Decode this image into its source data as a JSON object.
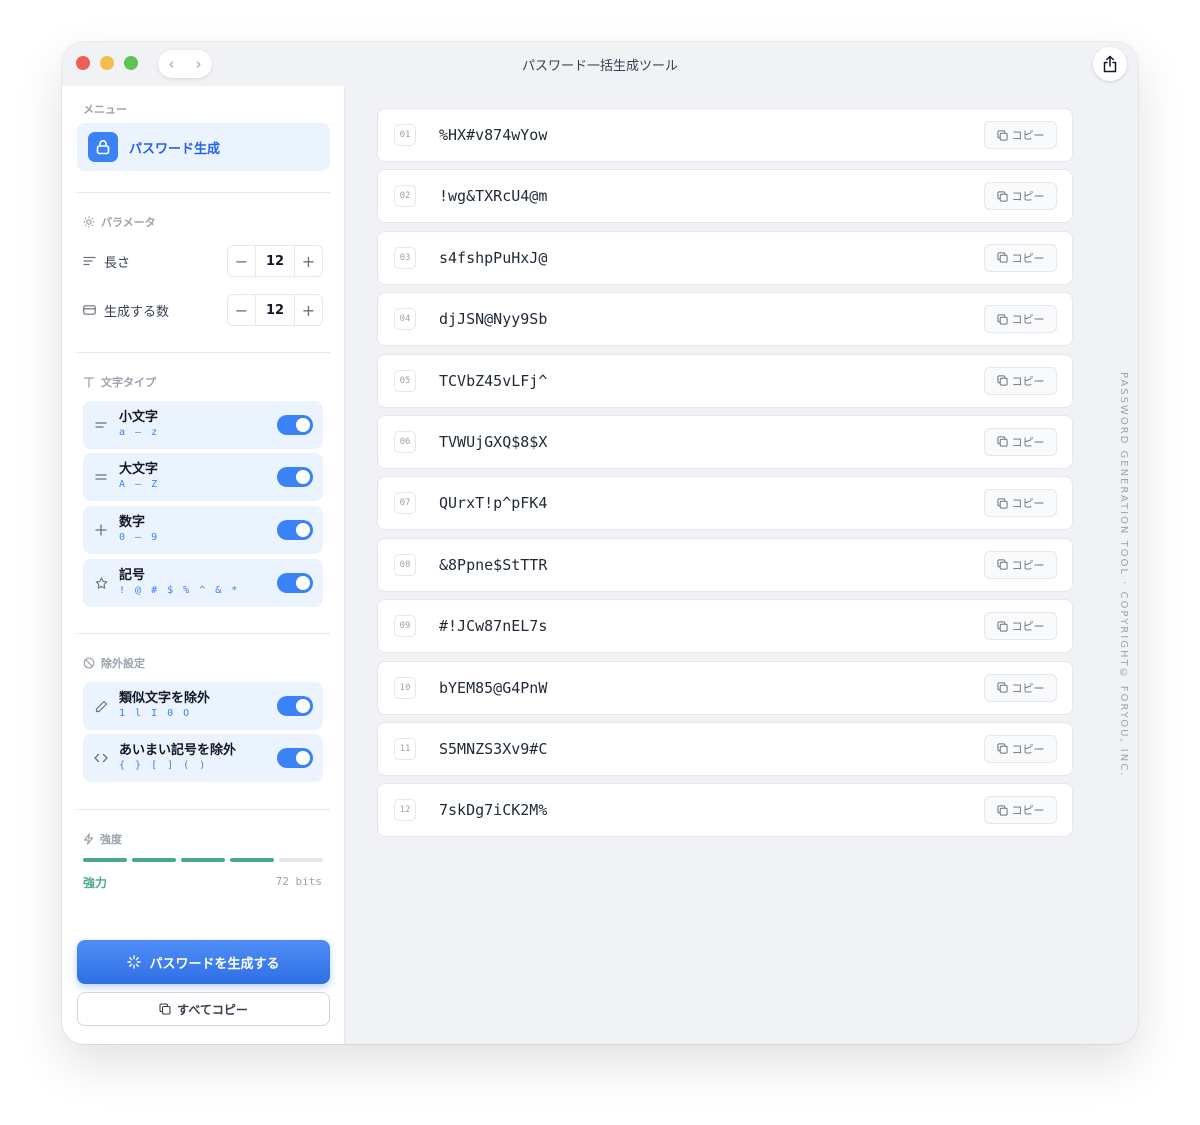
{
  "window": {
    "title": "パスワード一括生成ツール"
  },
  "sidebar": {
    "menu_label": "メニュー",
    "menu_item": "パスワード生成",
    "params": {
      "section": "パラメータ",
      "length_label": "長さ",
      "length_value": "12",
      "count_label": "生成する数",
      "count_value": "12",
      "minus": "−",
      "plus": "+"
    },
    "char_types": {
      "section": "文字タイプ",
      "items": [
        {
          "title": "小文字",
          "sub": "a – z",
          "enabled": true
        },
        {
          "title": "大文字",
          "sub": "A – Z",
          "enabled": true
        },
        {
          "title": "数字",
          "sub": "0 – 9",
          "enabled": true
        },
        {
          "title": "記号",
          "sub": "! @ # $ % ^ & *",
          "enabled": true
        }
      ]
    },
    "exclusions": {
      "section": "除外設定",
      "items": [
        {
          "title": "類似文字を除外",
          "sub": "1 l I 0 O",
          "enabled": true
        },
        {
          "title": "あいまい記号を除外",
          "sub": "{ } [ ] ( )",
          "enabled": true
        }
      ]
    },
    "strength": {
      "section": "強度",
      "label": "強力",
      "bits": "72 bits",
      "level": 0.8
    },
    "generate_button": "パスワードを生成する",
    "copy_all_button": "すべてコピー"
  },
  "passwords": [
    {
      "num": "01",
      "value": "%HX#v874wYow"
    },
    {
      "num": "02",
      "value": "!wg&TXRcU4@m"
    },
    {
      "num": "03",
      "value": "s4fshpPuHxJ@"
    },
    {
      "num": "04",
      "value": "djJSN@Nyy9Sb"
    },
    {
      "num": "05",
      "value": "TCVbZ45vLFj^"
    },
    {
      "num": "06",
      "value": "TVWUjGXQ$8$X"
    },
    {
      "num": "07",
      "value": "QUrxT!p^pFK4"
    },
    {
      "num": "08",
      "value": "&8Ppne$StTTR"
    },
    {
      "num": "09",
      "value": "#!JCw87nEL7s"
    },
    {
      "num": "10",
      "value": "bYEM85@G4PnW"
    },
    {
      "num": "11",
      "value": "S5MNZS3Xv9#C"
    },
    {
      "num": "12",
      "value": "7skDg7iCK2M%"
    }
  ],
  "copy_label": "コピー",
  "footer_vertical": "PASSWORD GENERATION TOOL · COPYRIGHT© FORYOU, INC.",
  "colors": {
    "accent": "#3b82f6",
    "strength": "#4aa88f",
    "card": "#ebf3fe"
  }
}
